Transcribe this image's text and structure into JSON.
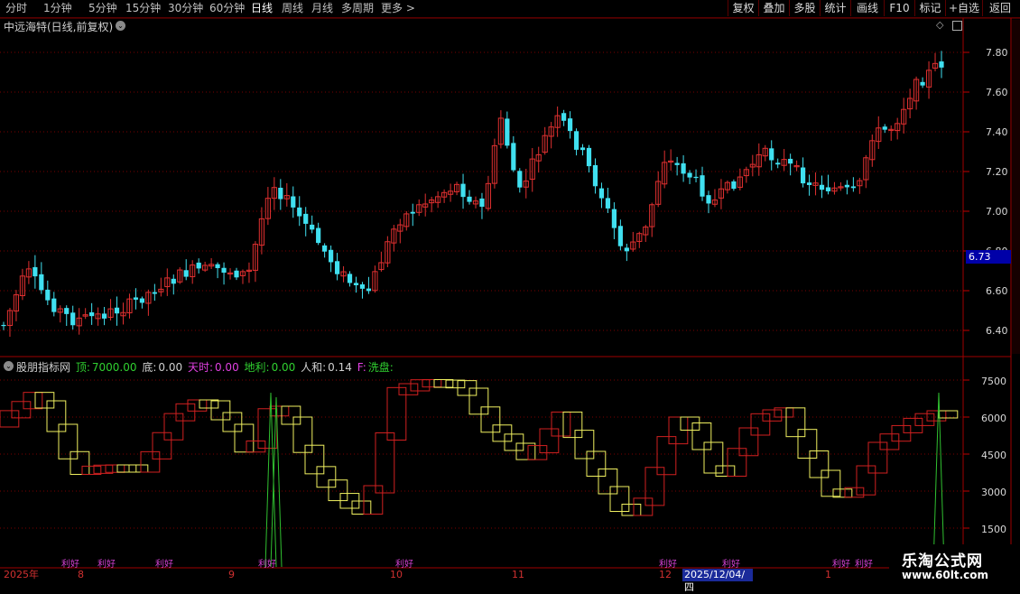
{
  "toolbar": {
    "periods": [
      "分时",
      "1分钟",
      "5分钟",
      "15分钟",
      "30分钟",
      "60分钟",
      "日线",
      "周线",
      "月线",
      "多周期",
      "更多 >"
    ],
    "active_period": "日线",
    "buttons": [
      "复权",
      "叠加",
      "多股",
      "统计",
      "画线",
      "F10",
      "标记",
      "+自选",
      "返回"
    ]
  },
  "main_chart": {
    "title": "中远海特(日线,前复权)",
    "price_ticks": [
      "7.80",
      "7.60",
      "7.40",
      "7.20",
      "7.00",
      "6.80",
      "6.60",
      "6.40"
    ],
    "current_price": "6.73",
    "colors": {
      "up": "#e03030",
      "down": "#40e0f0",
      "grid": "#7a0000"
    }
  },
  "indicator": {
    "name": "股朋指标网",
    "fields": [
      {
        "label": "顶:",
        "value": "7000.00",
        "color": "#30d030"
      },
      {
        "label": "底:",
        "value": "0.00",
        "color": "#d0d0d0"
      },
      {
        "label": "天时:",
        "value": "0.00",
        "color": "#e040e0"
      },
      {
        "label": "地利:",
        "value": "0.00",
        "color": "#30d030"
      },
      {
        "label": "人和:",
        "value": "0.14",
        "color": "#d0d0d0"
      },
      {
        "label": "F:",
        "value": "洗盘:",
        "color": "#e040e0"
      }
    ],
    "ticks": [
      "7500",
      "6000",
      "4500",
      "3000",
      "1500"
    ],
    "marker_label": "利好"
  },
  "time_axis": {
    "labels": [
      "2025年",
      "8",
      "9",
      "10",
      "11",
      "12",
      "1"
    ],
    "cursor_date": "2025/12/04/四"
  },
  "watermark": {
    "title": "乐淘公式网",
    "url": "www.60lt.com"
  }
}
